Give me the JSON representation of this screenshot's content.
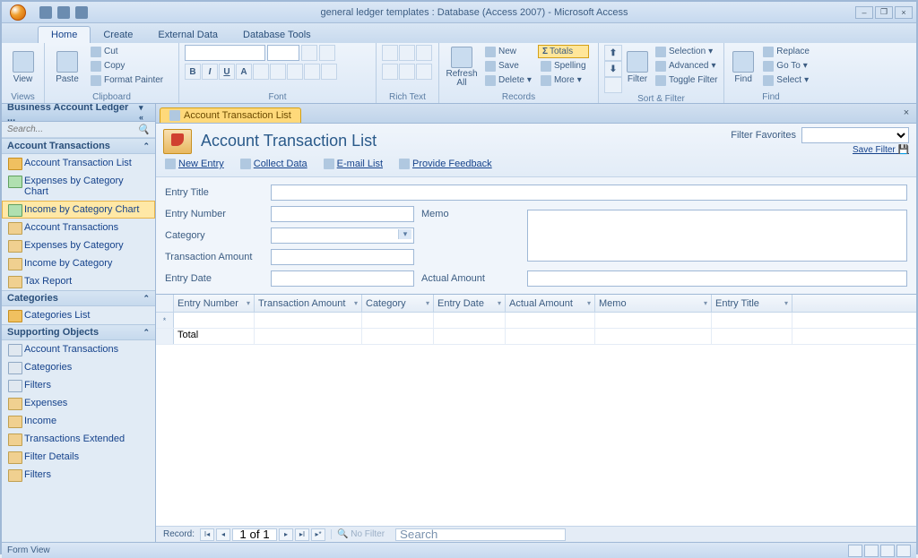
{
  "title": "general ledger templates : Database (Access 2007) - Microsoft Access",
  "tabs": {
    "home": "Home",
    "create": "Create",
    "external": "External Data",
    "tools": "Database Tools"
  },
  "ribbon": {
    "views": {
      "view": "View",
      "label": "Views"
    },
    "clipboard": {
      "paste": "Paste",
      "cut": "Cut",
      "copy": "Copy",
      "painter": "Format Painter",
      "label": "Clipboard"
    },
    "font": {
      "label": "Font"
    },
    "richtext": {
      "label": "Rich Text"
    },
    "records": {
      "refresh": "Refresh\nAll",
      "new": "New",
      "save": "Save",
      "delete": "Delete",
      "totals": "Totals",
      "spelling": "Spelling",
      "more": "More",
      "label": "Records"
    },
    "sortfilter": {
      "filter": "Filter",
      "selection": "Selection",
      "advanced": "Advanced",
      "toggle": "Toggle Filter",
      "label": "Sort & Filter"
    },
    "find": {
      "find": "Find",
      "replace": "Replace",
      "goto": "Go To",
      "select": "Select",
      "label": "Find"
    }
  },
  "nav": {
    "title": "Business Account Ledger ...",
    "search": "Search...",
    "sections": {
      "acct_trans": "Account Transactions",
      "categories": "Categories",
      "supporting": "Supporting Objects"
    },
    "items": {
      "atl": "Account Transaction List",
      "exp_chart": "Expenses by Category Chart",
      "inc_chart": "Income by Category Chart",
      "acct_tx": "Account Transactions",
      "exp_cat": "Expenses by Category",
      "inc_cat": "Income by Category",
      "tax": "Tax Report",
      "cat_list": "Categories List",
      "s_acct": "Account Transactions",
      "s_cat": "Categories",
      "s_filters": "Filters",
      "s_exp": "Expenses",
      "s_inc": "Income",
      "s_txext": "Transactions Extended",
      "s_fdet": "Filter Details",
      "s_filt2": "Filters"
    }
  },
  "doc": {
    "tab": "Account Transaction List",
    "title": "Account Transaction List",
    "filter_fav": "Filter Favorites",
    "save_filter": "Save Filter",
    "links": {
      "new": "New Entry",
      "collect": "Collect Data",
      "email": "E-mail List",
      "feedback": "Provide Feedback"
    },
    "fields": {
      "entry_title": "Entry Title",
      "entry_number": "Entry Number",
      "category": "Category",
      "tx_amount": "Transaction Amount",
      "entry_date": "Entry Date",
      "memo": "Memo",
      "actual_amount": "Actual Amount"
    },
    "cols": [
      "Entry Number",
      "Transaction Amount",
      "Category",
      "Entry Date",
      "Actual Amount",
      "Memo",
      "Entry Title"
    ],
    "total": "Total"
  },
  "recnav": {
    "label": "Record:",
    "pos": "1 of 1",
    "nofilter": "No Filter",
    "search": "Search"
  },
  "status": "Form View"
}
